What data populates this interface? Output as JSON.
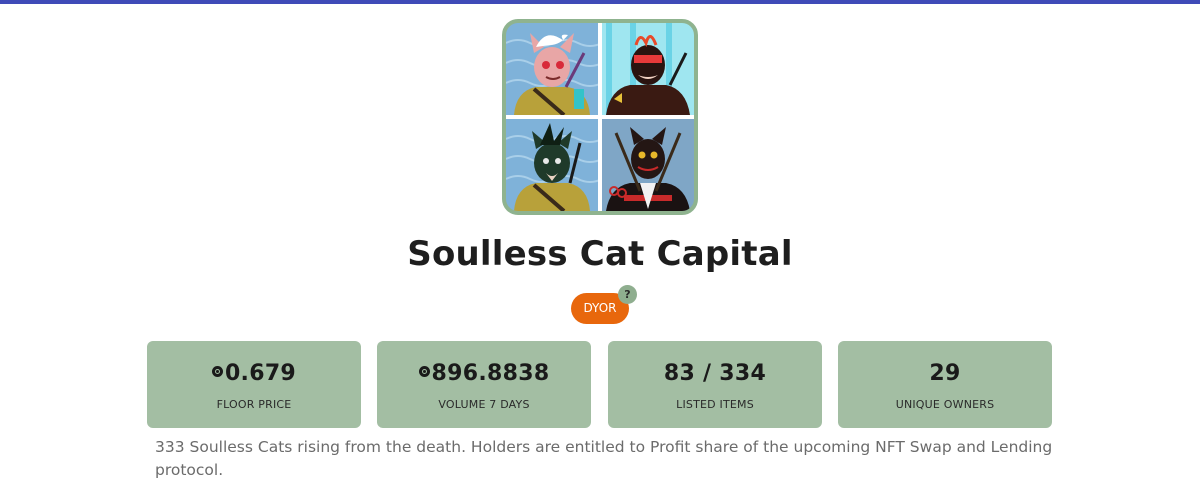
{
  "colors": {
    "top_bar": "#3f4bb8",
    "card_background": "#a3bea3",
    "image_border": "#8fb38f",
    "dyor_badge": "#e8670c"
  },
  "collection": {
    "title": "Soulless Cat Capital",
    "image_alt": "Soulless Cat Capital collection preview",
    "badge_label": "DYOR",
    "badge_help": "?",
    "description": "333 Soulless Cats rising from the death. Holders are entitled to Profit share of the upcoming NFT Swap and Lending protocol."
  },
  "stats": [
    {
      "value": "0.679",
      "label": "FLOOR PRICE",
      "icon": "solana-icon"
    },
    {
      "value": "896.8838",
      "label": "VOLUME 7 DAYS",
      "icon": "solana-icon"
    },
    {
      "value": "83 / 334",
      "label": "LISTED ITEMS",
      "icon": ""
    },
    {
      "value": "29",
      "label": "UNIQUE OWNERS",
      "icon": ""
    }
  ]
}
